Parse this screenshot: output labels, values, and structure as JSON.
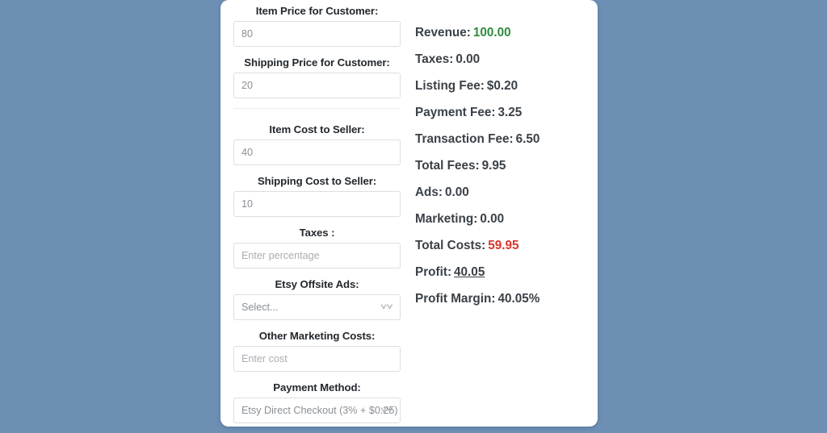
{
  "theme": {
    "page_background": "#6d8fb3",
    "card_background": "#ffffff",
    "label_color": "#23282d",
    "result_label_color": "#3a4148",
    "positive_color": "#2e8b3d",
    "negative_color": "#d9342b"
  },
  "form": {
    "fields": [
      {
        "name": "item-price-for-customer",
        "label": "Item Price for Customer:",
        "type": "input",
        "value": "80",
        "placeholder": ""
      },
      {
        "name": "shipping-price-for-customer",
        "label": "Shipping Price for Customer:",
        "type": "input",
        "value": "20",
        "placeholder": ""
      },
      {
        "name": "item-cost-to-seller",
        "label": "Item Cost to Seller:",
        "type": "input",
        "value": "40",
        "placeholder": ""
      },
      {
        "name": "shipping-cost-to-seller",
        "label": "Shipping Cost to Seller:",
        "type": "input",
        "value": "10",
        "placeholder": ""
      },
      {
        "name": "taxes",
        "label": "Taxes :",
        "type": "input",
        "value": "",
        "placeholder": "Enter percentage"
      },
      {
        "name": "etsy-offsite-ads",
        "label": "Etsy Offsite Ads:",
        "type": "select",
        "value": "Select...",
        "placeholder": ""
      },
      {
        "name": "other-marketing-costs",
        "label": "Other Marketing Costs:",
        "type": "input",
        "value": "",
        "placeholder": "Enter cost"
      },
      {
        "name": "payment-method",
        "label": "Payment Method:",
        "type": "select",
        "value": "Etsy Direct Checkout (3% + $0.25)",
        "placeholder": ""
      }
    ]
  },
  "results": {
    "rows": [
      {
        "name": "revenue",
        "label": "Revenue:",
        "value": "100.00",
        "style": "green"
      },
      {
        "name": "taxes",
        "label": "Taxes:",
        "value": "0.00",
        "style": "normal"
      },
      {
        "name": "listing-fee",
        "label": "Listing Fee:",
        "value": "$0.20",
        "style": "normal"
      },
      {
        "name": "payment-fee",
        "label": "Payment Fee:",
        "value": "3.25",
        "style": "normal"
      },
      {
        "name": "transaction-fee",
        "label": "Transaction Fee:",
        "value": "6.50",
        "style": "normal"
      },
      {
        "name": "total-fees",
        "label": "Total Fees:",
        "value": "9.95",
        "style": "normal"
      },
      {
        "name": "ads",
        "label": "Ads:",
        "value": "0.00",
        "style": "normal"
      },
      {
        "name": "marketing",
        "label": "Marketing:",
        "value": "0.00",
        "style": "normal"
      },
      {
        "name": "total-costs",
        "label": "Total Costs:",
        "value": "59.95",
        "style": "red"
      },
      {
        "name": "profit",
        "label": "Profit:",
        "value": "40.05",
        "style": "underline"
      },
      {
        "name": "profit-margin",
        "label": "Profit Margin:",
        "value": "40.05%",
        "style": "normal"
      }
    ]
  },
  "icons": {
    "select_chevron": "chevron-down-icon"
  }
}
